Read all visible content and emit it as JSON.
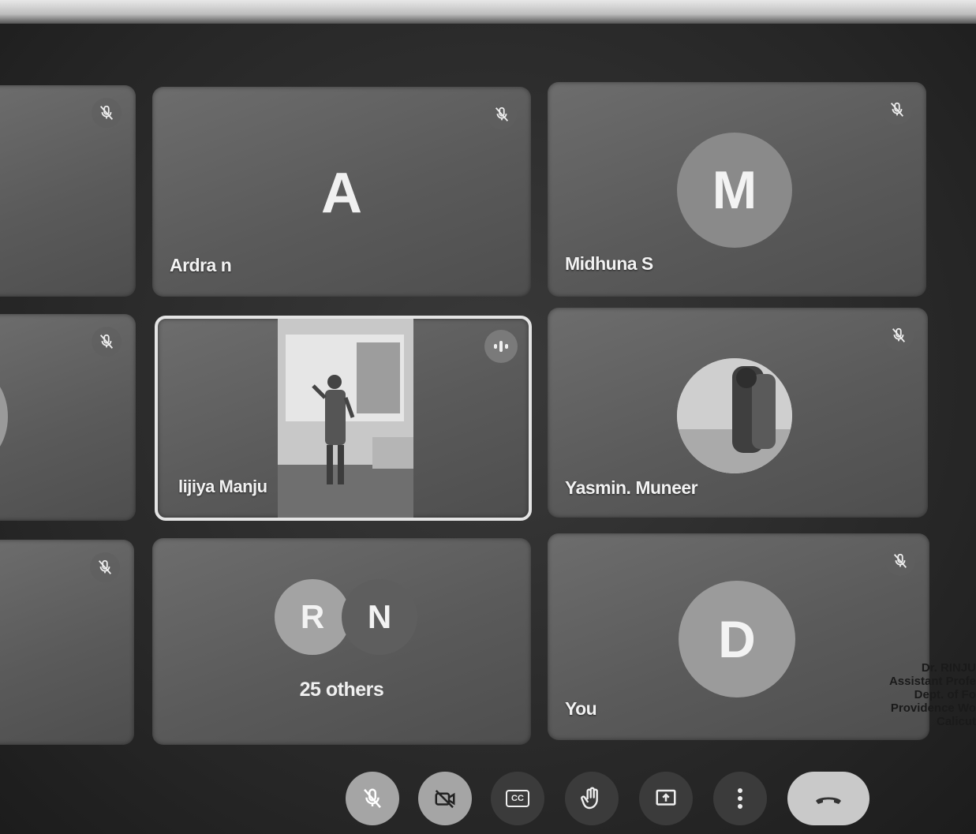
{
  "participants": [
    {
      "name": "Ardra n",
      "initial": "A",
      "muted": true
    },
    {
      "name": "Midhuna S",
      "initial": "M",
      "muted": true
    },
    {
      "name": "lijiya Manju",
      "initial": "",
      "muted": false,
      "speaking": true,
      "video": true
    },
    {
      "name": "Yasmin. Muneer",
      "initial": "",
      "muted": true,
      "photo_avatar": true
    },
    {
      "name": "You",
      "initial": "D",
      "muted": true
    }
  ],
  "others_tile": {
    "initials": [
      "R",
      "N"
    ],
    "label": "25 others"
  },
  "controls": [
    {
      "name": "microphone",
      "icon": "mic-off-icon"
    },
    {
      "name": "camera",
      "icon": "camera-off-icon"
    },
    {
      "name": "captions",
      "icon": "closed-captions-icon",
      "text": "CC"
    },
    {
      "name": "raise-hand",
      "icon": "hand-icon"
    },
    {
      "name": "present",
      "icon": "present-screen-icon"
    },
    {
      "name": "more-options",
      "icon": "more-vert-icon"
    },
    {
      "name": "leave-call",
      "icon": "end-call-icon"
    }
  ],
  "stamp": {
    "line1": "Dr. RINJU",
    "line2": "Assistant Profe",
    "line3": "Dept. of Fo",
    "line4": "Providence Wo",
    "line5": "Calicut"
  },
  "colors": {
    "tile": "#5e5e5e",
    "background": "#2b2b2b",
    "leave": "#c9c9c9"
  }
}
